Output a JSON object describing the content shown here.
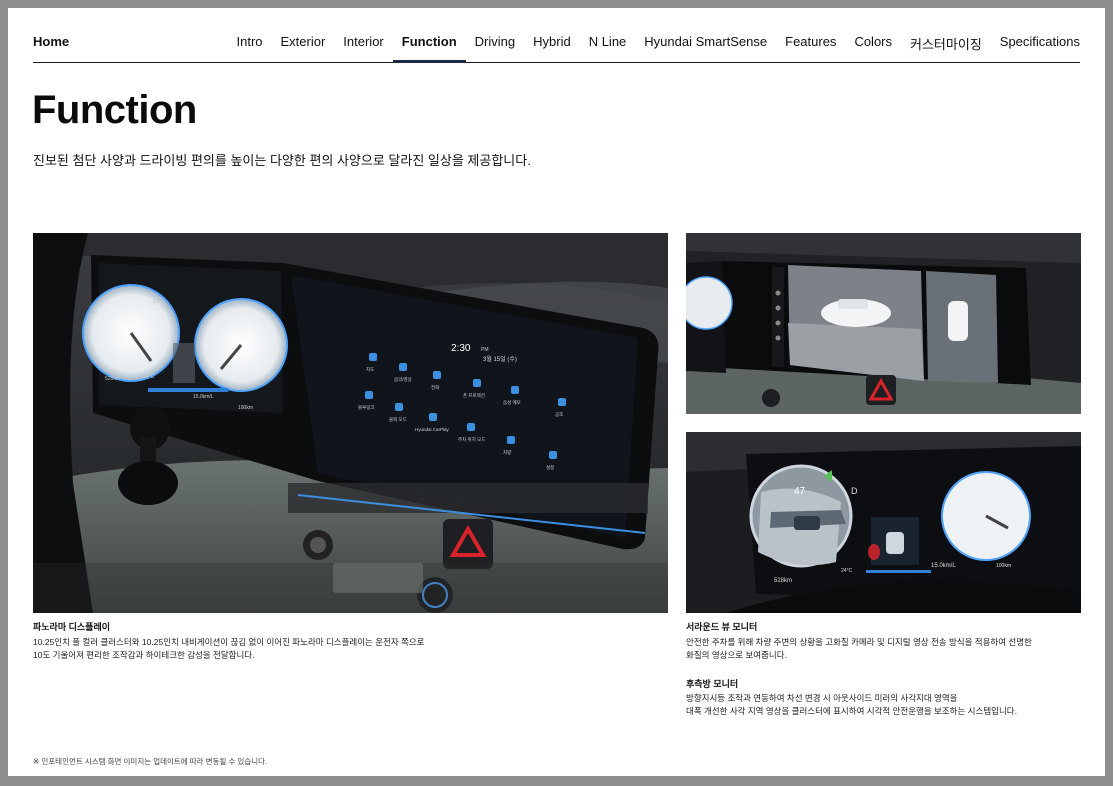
{
  "nav": {
    "home_label": "Home",
    "tabs": [
      {
        "label": "Intro"
      },
      {
        "label": "Exterior"
      },
      {
        "label": "Interior"
      },
      {
        "label": "Function",
        "active": true
      },
      {
        "label": "Driving"
      },
      {
        "label": "Hybrid"
      },
      {
        "label": "N Line"
      },
      {
        "label": "Hyundai SmartSense"
      },
      {
        "label": "Features"
      },
      {
        "label": "Colors"
      },
      {
        "label": "커스터마이징"
      },
      {
        "label": "Specifications"
      }
    ]
  },
  "header": {
    "title": "Function",
    "description": "진보된 첨단 사양과 드라이빙 편의를 높이는 다양한 편의 사양으로 달라진 일상을 제공합니다."
  },
  "screens": {
    "time": "2:30",
    "time_suffix": "PM",
    "date": "3월 15일 (수)",
    "gear_left": "P",
    "gear_right": "D",
    "speed_small": "47",
    "range_left": "528km",
    "temp": "24°C",
    "odo": "100km",
    "fuel": "15.0km/L",
    "apps": [
      "지도",
      "음악/영상",
      "전화",
      "폰 프로젝션",
      "음성 메모",
      "공조",
      "블루링크",
      "블랙 모드",
      "Hyundai CarPlay",
      "주차 위치 모드",
      "차량",
      "설정"
    ]
  },
  "captions": {
    "panorama": {
      "title": "파노라마 디스플레이",
      "line1": "10.25인치 풀 컬러 클러스터와 10.25인치 내비게이션이 끊김 없이 이어진 파노라마 디스플레이는 운전자 쪽으로",
      "line2": "10도 기울어져 편리한 조작감과 하이테크한 감성을 전달합니다."
    },
    "surround": {
      "title": "서라운드 뷰 모니터",
      "line1": "안전한 주차를 위해 차량 주변의 상황을 고화질 카메라 및 디지털 영상 전송 방식을 적용하여 선명한",
      "line2": "화질의 영상으로 보여줍니다."
    },
    "rear": {
      "title": "후측방 모니터",
      "line1": "방향지시등 조작과 연동하여 차선 변경 시 아웃사이드 미러의 사각지대 영역을",
      "line2": "대폭 개선한 사각 지역 영상을 클러스터에 표시하여 시각적 안전운행을 보조하는 시스템입니다."
    }
  },
  "footnote": "※ 인포테인먼트 시스템 화면 이미지는 업데이트에 따라 변동될 수 있습니다.",
  "colors": {
    "nav_active": "#1f2a44",
    "hazard": "#d8232a",
    "accent_blue": "#4da3ff"
  }
}
